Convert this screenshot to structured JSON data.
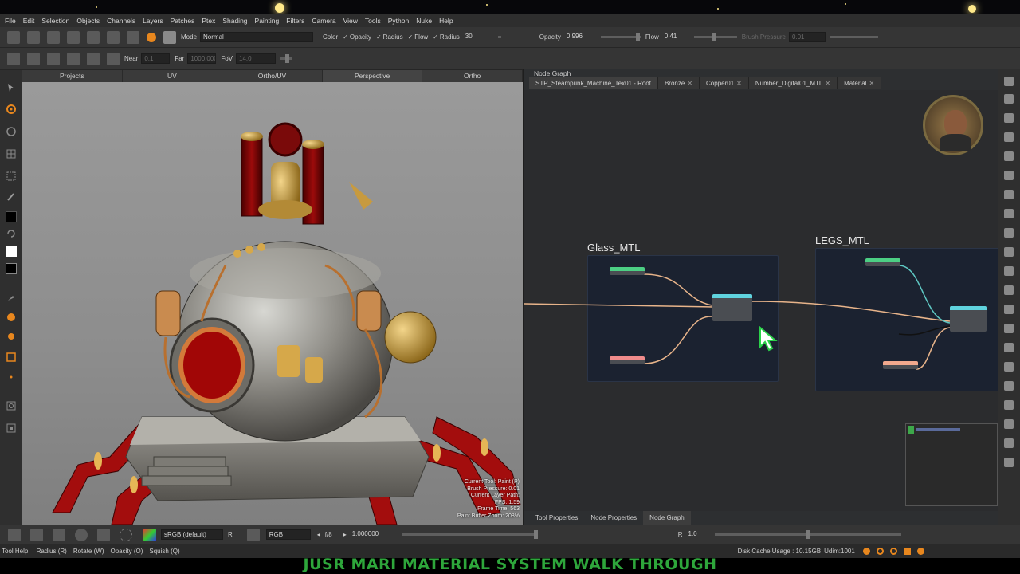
{
  "menu": [
    "File",
    "Edit",
    "Selection",
    "Objects",
    "Channels",
    "Layers",
    "Patches",
    "Ptex",
    "Shading",
    "Painting",
    "Filters",
    "Camera",
    "View",
    "Tools",
    "Python",
    "Nuke",
    "Help"
  ],
  "toolbar1": {
    "mode_label": "Mode",
    "mode_value": "Normal",
    "color_label": "Color",
    "opacity_label": "Opacity",
    "radius_label": "Radius",
    "flow_label": "Flow",
    "radius_value_label": "Radius",
    "radius_value": "30",
    "opacity_value_label": "Opacity",
    "opacity_value": "0.996",
    "flow_value_label": "Flow",
    "flow_value": "0.41",
    "brush_pressure_label": "Brush Pressure",
    "brush_pressure_value": "0.01"
  },
  "toolbar2": {
    "near_label": "Near",
    "near_value": "0.1",
    "far_label": "Far",
    "far_value": "1000.000",
    "fov_label": "FoV",
    "fov_value": "14.0"
  },
  "viewport_tabs": [
    "Projects",
    "UV",
    "Ortho/UV",
    "Perspective",
    "Ortho"
  ],
  "hud": [
    "Current Tool: Paint (P)",
    "Brush Pressure: 0.01",
    "Current Layer Path:",
    "FPS: 1.59",
    "Frame Time: 563",
    "Paint Buffer Zoom: 208%"
  ],
  "node_graph": {
    "title": "Node Graph",
    "tabs": [
      "STP_Steampunk_Machine_Tex01 - Root",
      "Bronze",
      "Copper01",
      "Number_Digital01_MTL",
      "Material"
    ],
    "backdrops": {
      "glass": "Glass_MTL",
      "legs": "LEGS_MTL"
    },
    "bottom_tabs": [
      "Tool Properties",
      "Node Properties",
      "Node Graph"
    ]
  },
  "statusbar": {
    "colorspace": "sRGB (default)",
    "r_label": "R",
    "channels": "RGB",
    "fstop": "f/8",
    "exposure": "1.000000",
    "r2_label": "R",
    "r2_value": "1.0"
  },
  "helpbar": {
    "tool_help": "Tool Help:",
    "radius": "Radius (R)",
    "rotate": "Rotate (W)",
    "opacity": "Opacity (O)",
    "squish": "Squish (Q)",
    "disk_cache": "Disk Cache Usage : 10.15GB",
    "udim": "Udim:1001"
  },
  "caption": "JUSR MARI MATERIAL SYSTEM WALK THROUGH",
  "colors": {
    "accent_orange": "#e8871e",
    "caption_green": "#2ea63b",
    "backdrop_blue": "#1b2230",
    "wire_orange": "#e8b48a",
    "wire_teal": "#5fc9c4",
    "cursor_green": "#2bd14a"
  }
}
